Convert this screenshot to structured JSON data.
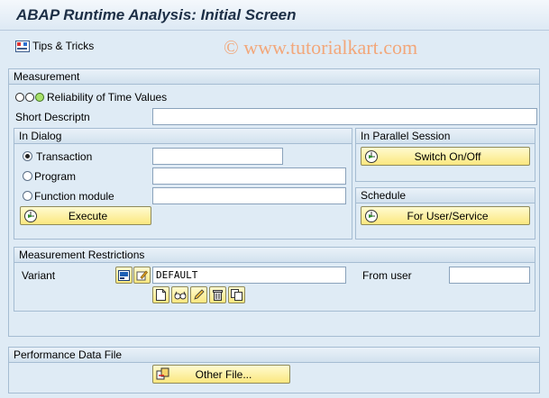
{
  "window": {
    "title": "ABAP Runtime Analysis: Initial Screen"
  },
  "toolbar": {
    "tips_label": "Tips & Tricks",
    "watermark": "© www.tutorialkart.com"
  },
  "measurement": {
    "header": "Measurement",
    "reliability_label": "Reliability of Time Values",
    "short_desc_label": "Short Descriptn",
    "short_desc_value": ""
  },
  "in_dialog": {
    "header": "In Dialog",
    "options": [
      {
        "label": "Transaction",
        "value": "",
        "selected": true
      },
      {
        "label": "Program",
        "value": "",
        "selected": false
      },
      {
        "label": "Function module",
        "value": "",
        "selected": false
      }
    ],
    "execute_label": "Execute"
  },
  "parallel": {
    "header": "In Parallel Session",
    "switch_label": "Switch On/Off"
  },
  "schedule": {
    "header": "Schedule",
    "user_service_label": "For User/Service"
  },
  "restrictions": {
    "header": "Measurement Restrictions",
    "variant_label": "Variant",
    "variant_value": "DEFAULT",
    "from_user_label": "From user",
    "from_user_value": ""
  },
  "perf_file": {
    "header": "Performance Data File",
    "other_file_label": "Other File..."
  },
  "colors": {
    "background": "#dfebf5",
    "button": "#fbe77f",
    "title": "#1d2f46"
  }
}
